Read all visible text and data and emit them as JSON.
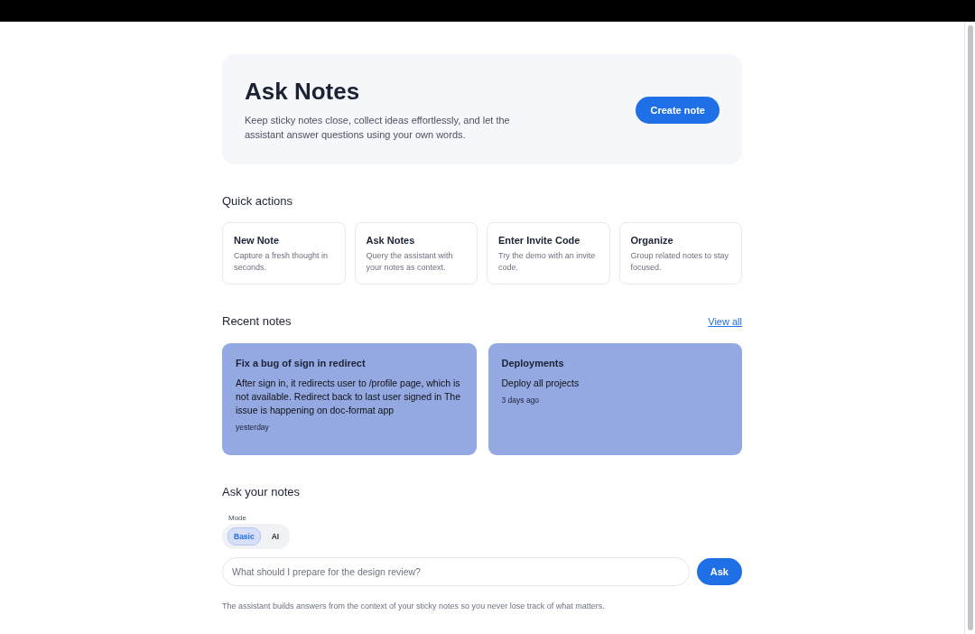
{
  "hero": {
    "title": "Ask Notes",
    "description": "Keep sticky notes close, collect ideas effortlessly, and let the assistant answer questions using your own words.",
    "button": "Create note"
  },
  "quick_actions": {
    "heading": "Quick actions",
    "items": [
      {
        "title": "New Note",
        "description": "Capture a fresh thought in seconds."
      },
      {
        "title": "Ask Notes",
        "description": "Query the assistant with your notes as context."
      },
      {
        "title": "Enter Invite Code",
        "description": "Try the demo with an invite code."
      },
      {
        "title": "Organize",
        "description": "Group related notes to stay focused."
      }
    ]
  },
  "recent_notes": {
    "heading": "Recent notes",
    "link": "View all",
    "notes": [
      {
        "title": "Fix a bug of sign in redirect",
        "body": "After sign in, it redirects user to /profile page, which is not available. Redirect back to last user signed in The issue is happening on doc-format app",
        "time": "yesterday"
      },
      {
        "title": "Deployments",
        "body": "Deploy all projects",
        "time": "3 days ago"
      }
    ]
  },
  "ask": {
    "heading": "Ask your notes",
    "mode_label": "Mode",
    "modes": [
      {
        "label": "Basic",
        "selected": true
      },
      {
        "label": "AI",
        "selected": false
      }
    ],
    "placeholder": "What should I prepare for the design review?",
    "button": "Ask",
    "footnote": "The assistant builds answers from the context of your sticky notes so you never lose track of what matters."
  }
}
